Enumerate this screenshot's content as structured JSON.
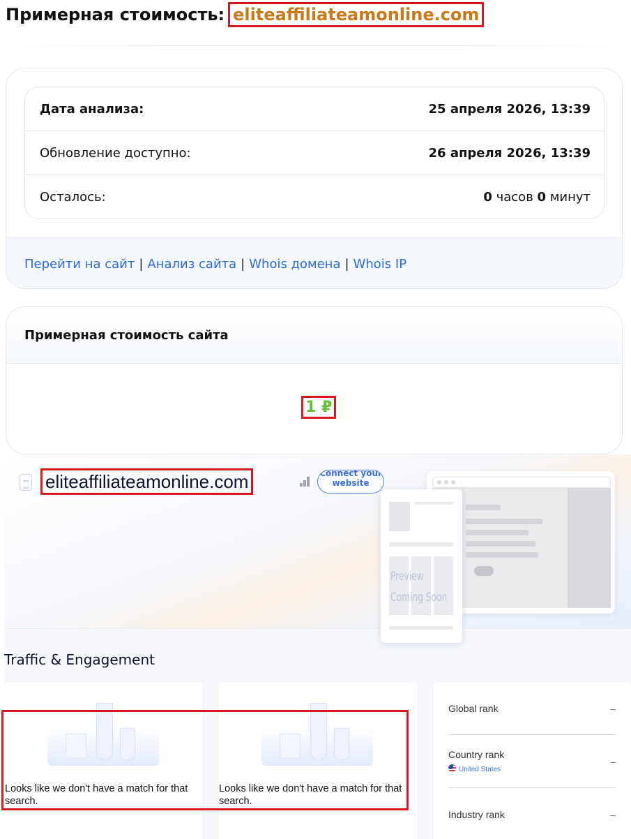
{
  "header": {
    "label": "Примерная стоимость:",
    "domain": "eliteaffiliateamonline.com"
  },
  "info": {
    "rows": [
      {
        "key": "Дата анализа:",
        "value": "25 апреля 2026, 13:39"
      },
      {
        "key": "Обновление доступно:",
        "value": "26 апреля 2026, 13:39"
      },
      {
        "key": "Осталось:",
        "hours_num": "0",
        "hours_word": "часов",
        "minutes_num": "0",
        "minutes_word": "минут"
      }
    ],
    "links": [
      "Перейти на сайт",
      "Анализ сайта",
      "Whois домена",
      "Whois IP"
    ],
    "separator": "|"
  },
  "price": {
    "title": "Примерная стоимость сайта",
    "value": "1 ₽"
  },
  "similarweb": {
    "domain": "eliteaffiliateamonline.com",
    "connect_label": "Connect your website",
    "preview_line1": "Preview",
    "preview_line2": "Coming Soon",
    "section_title": "Traffic & Engagement",
    "empty_text": "Looks like we don't have a match for that search.",
    "ranks": [
      {
        "label": "Global rank",
        "value": "–"
      },
      {
        "label": "Country rank",
        "sub": "United States",
        "value": "–"
      },
      {
        "label": "Industry rank",
        "value": "–"
      }
    ]
  },
  "colors": {
    "accent_domain": "#c87a18",
    "price_green": "#6abf3a",
    "link_blue": "#2e6bd6",
    "highlight_red": "#d8191f"
  }
}
